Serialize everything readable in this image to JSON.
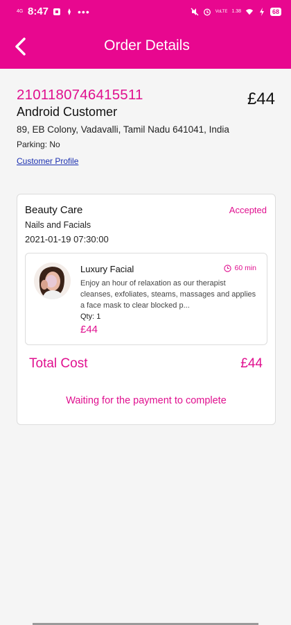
{
  "status_bar": {
    "time": "8:47",
    "network_tag": "4G",
    "battery": "68",
    "signal_tag": "VoLTE",
    "speed": "1.38"
  },
  "header": {
    "title": "Order Details",
    "back_icon": "chevron-left-icon"
  },
  "order": {
    "id": "2101180746415511",
    "total": "£44",
    "customer_name": "Android Customer",
    "address": "89, EB Colony, Vadavalli, Tamil Nadu 641041, India",
    "parking": "Parking: No",
    "profile_link": "Customer Profile"
  },
  "booking": {
    "category": "Beauty Care",
    "status": "Accepted",
    "subcategory": "Nails and Facials",
    "datetime": "2021-01-19 07:30:00",
    "service": {
      "name": "Luxury Facial",
      "duration": "60 min",
      "description": "Enjoy an hour of relaxation as our therapist cleanses, exfoliates, steams, massages and applies a face mask to clear blocked p...",
      "qty": "Qty: 1",
      "price": "£44"
    },
    "total_label": "Total Cost",
    "total_value": "£44",
    "payment_status": "Waiting for the payment to complete"
  },
  "colors": {
    "brand": "#e8078f",
    "link": "#1a2fb0"
  }
}
